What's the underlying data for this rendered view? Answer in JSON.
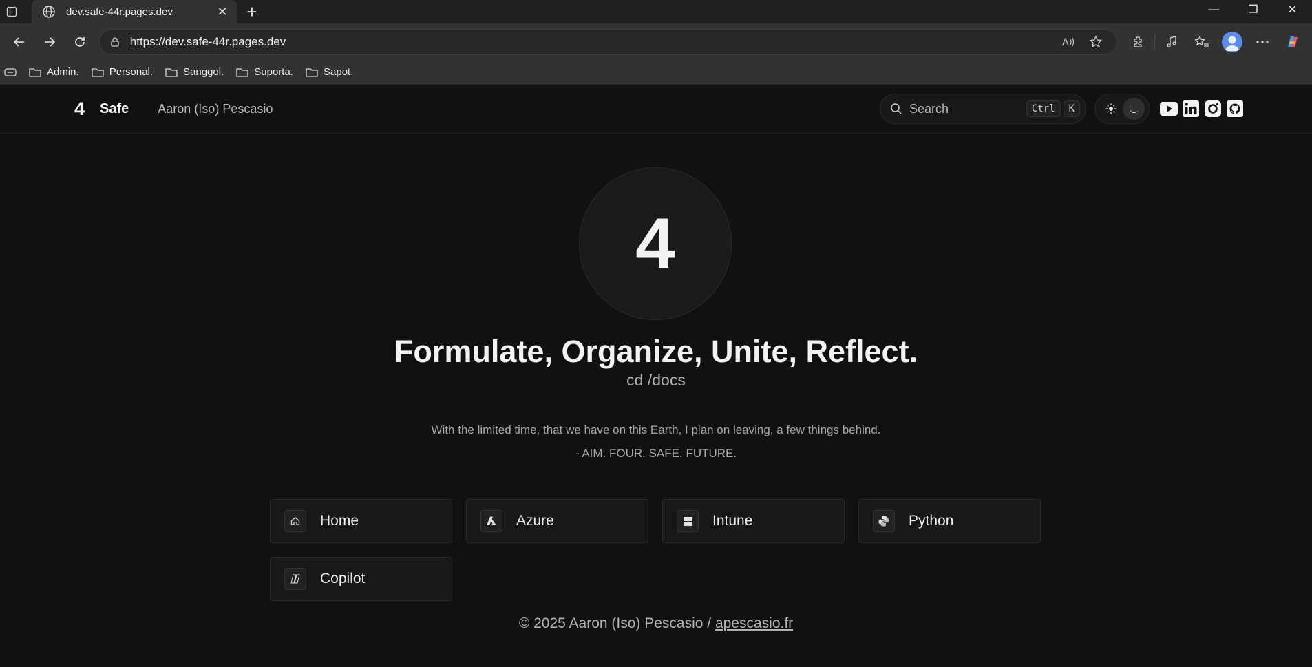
{
  "browser": {
    "tab_title": "dev.safe-44r.pages.dev",
    "url": "https://dev.safe-44r.pages.dev",
    "bookmarks": [
      "Admin.",
      "Personal.",
      "Sanggol.",
      "Suporta.",
      "Sapot."
    ]
  },
  "header": {
    "logo": "4",
    "site_name": "Safe",
    "author": "Aaron (Iso) Pescasio",
    "search_label": "Search",
    "shortcut_ctrl": "Ctrl",
    "shortcut_key": "K"
  },
  "hero": {
    "emblem": "4",
    "title": "Formulate, Organize, Unite, Reflect.",
    "subtitle": "cd /docs",
    "quote": "With the limited time, that we have on this Earth, I plan on leaving, a few things behind.",
    "quote_signature": "- AIM. FOUR. SAFE. FUTURE."
  },
  "cards": [
    {
      "label": "Home",
      "icon": "home-icon"
    },
    {
      "label": "Azure",
      "icon": "azure-icon"
    },
    {
      "label": "Intune",
      "icon": "windows-icon"
    },
    {
      "label": "Python",
      "icon": "python-icon"
    },
    {
      "label": "Copilot",
      "icon": "copilot-icon"
    }
  ],
  "footer": {
    "copyright": "© 2025 Aaron (Iso) Pescasio / ",
    "link_text": "apescasio.fr"
  },
  "colors": {
    "background": "#111111",
    "browser_chrome": "#323232",
    "avatar": "#5b8de8"
  }
}
